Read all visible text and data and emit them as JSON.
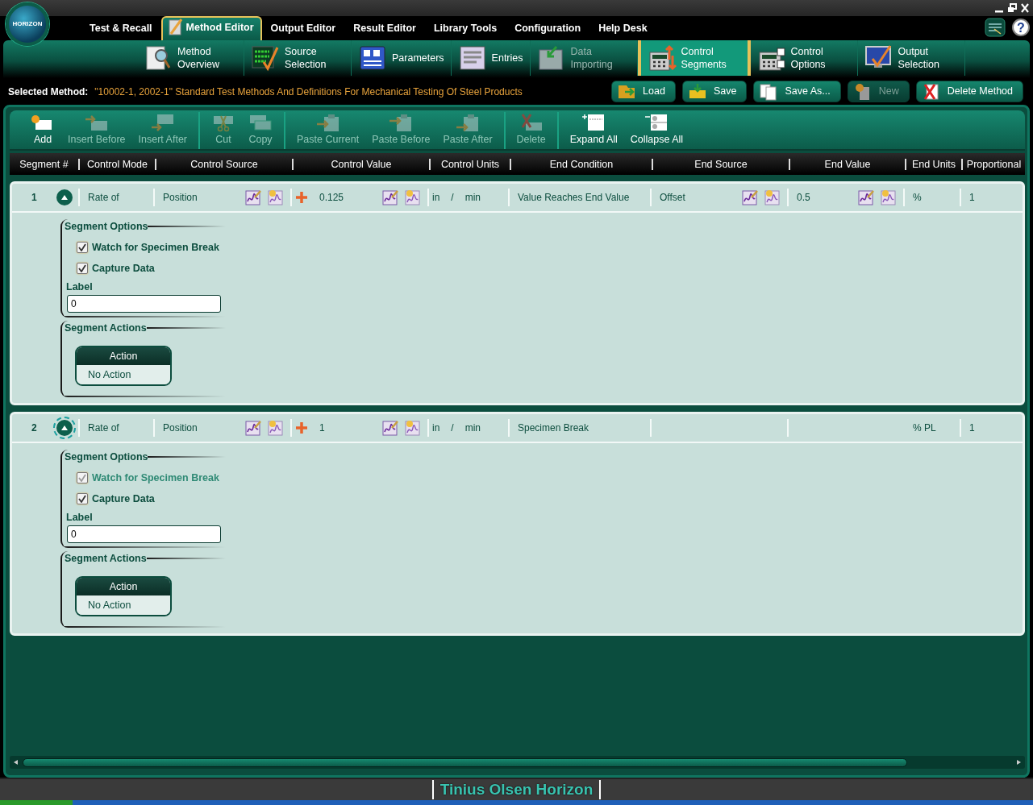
{
  "logo": "HORIZON",
  "main_tabs": [
    {
      "label": "Test & Recall",
      "selected": false
    },
    {
      "label": "Method Editor",
      "selected": true
    },
    {
      "label": "Output Editor",
      "selected": false
    },
    {
      "label": "Result Editor",
      "selected": false
    },
    {
      "label": "Library Tools",
      "selected": false
    },
    {
      "label": "Configuration",
      "selected": false
    },
    {
      "label": "Help Desk",
      "selected": false
    }
  ],
  "help": "?",
  "sub_tabs": [
    {
      "label": "Method Overview",
      "selected": false,
      "disabled": false
    },
    {
      "label": "Source Selection",
      "selected": false,
      "disabled": false
    },
    {
      "label": "Parameters",
      "selected": false,
      "disabled": false
    },
    {
      "label": "Entries",
      "selected": false,
      "disabled": false
    },
    {
      "label": "Data Importing",
      "selected": false,
      "disabled": true
    },
    {
      "label": "Control Segments",
      "selected": true,
      "disabled": false
    },
    {
      "label": "Control Options",
      "selected": false,
      "disabled": false
    },
    {
      "label": "Output Selection",
      "selected": false,
      "disabled": false
    }
  ],
  "selected_method": {
    "label": "Selected Method:",
    "value": "\"10002-1, 2002-1\" Standard Test Methods And Definitions For Mechanical Testing Of Steel Products"
  },
  "method_buttons": [
    {
      "label": "Load",
      "disabled": false
    },
    {
      "label": "Save",
      "disabled": false
    },
    {
      "label": "Save As...",
      "disabled": false
    },
    {
      "label": "New",
      "disabled": true
    },
    {
      "label": "Delete Method",
      "disabled": false
    }
  ],
  "toolbar": {
    "groups": [
      {
        "items": [
          {
            "label": "Add",
            "disabled": false
          },
          {
            "label": "Insert Before",
            "disabled": true
          },
          {
            "label": "Insert After",
            "disabled": true
          }
        ]
      },
      {
        "items": [
          {
            "label": "Cut",
            "disabled": true
          },
          {
            "label": "Copy",
            "disabled": true
          }
        ]
      },
      {
        "items": [
          {
            "label": "Paste Current",
            "disabled": true
          },
          {
            "label": "Paste Before",
            "disabled": true
          },
          {
            "label": "Paste After",
            "disabled": true
          }
        ]
      },
      {
        "items": [
          {
            "label": "Delete",
            "disabled": true
          }
        ]
      },
      {
        "items": [
          {
            "label": "Expand All",
            "disabled": false
          },
          {
            "label": "Collapse All",
            "disabled": false
          }
        ]
      }
    ]
  },
  "columns": [
    "Segment #",
    "Control Mode",
    "Control Source",
    "Control Value",
    "Control Units",
    "End Condition",
    "End Source",
    "End Value",
    "End Units",
    "Proportional"
  ],
  "segments": [
    {
      "number": "1",
      "expanded": true,
      "focused": false,
      "control_mode": "Rate of",
      "control_source": "Position",
      "control_value": "0.125",
      "control_units": [
        "in",
        "/",
        "min"
      ],
      "end_condition": "Value Reaches End Value",
      "end_source": "Offset",
      "end_value": "0.5",
      "end_units": "%",
      "proportional": "1",
      "options_title": "Segment Options",
      "checkboxes": [
        {
          "label": "Watch for Specimen Break",
          "checked": true,
          "disabled": false
        },
        {
          "label": "Capture Data",
          "checked": true,
          "disabled": false
        }
      ],
      "label_caption": "Label",
      "label_value": "0",
      "actions_title": "Segment Actions",
      "actions_column": "Action",
      "actions": [
        "No Action"
      ]
    },
    {
      "number": "2",
      "expanded": true,
      "focused": true,
      "control_mode": "Rate of",
      "control_source": "Position",
      "control_value": "1",
      "control_units": [
        "in",
        "/",
        "min"
      ],
      "end_condition": "Specimen Break",
      "end_units": "% PL",
      "proportional": "1",
      "options_title": "Segment Options",
      "checkboxes": [
        {
          "label": "Watch for Specimen Break",
          "checked": true,
          "disabled": true
        },
        {
          "label": "Capture Data",
          "checked": true,
          "disabled": false
        }
      ],
      "label_caption": "Label",
      "label_value": "0",
      "actions_title": "Segment Actions",
      "actions_column": "Action",
      "actions": [
        "No Action"
      ]
    }
  ],
  "status_bar": "Tinius Olsen Horizon"
}
